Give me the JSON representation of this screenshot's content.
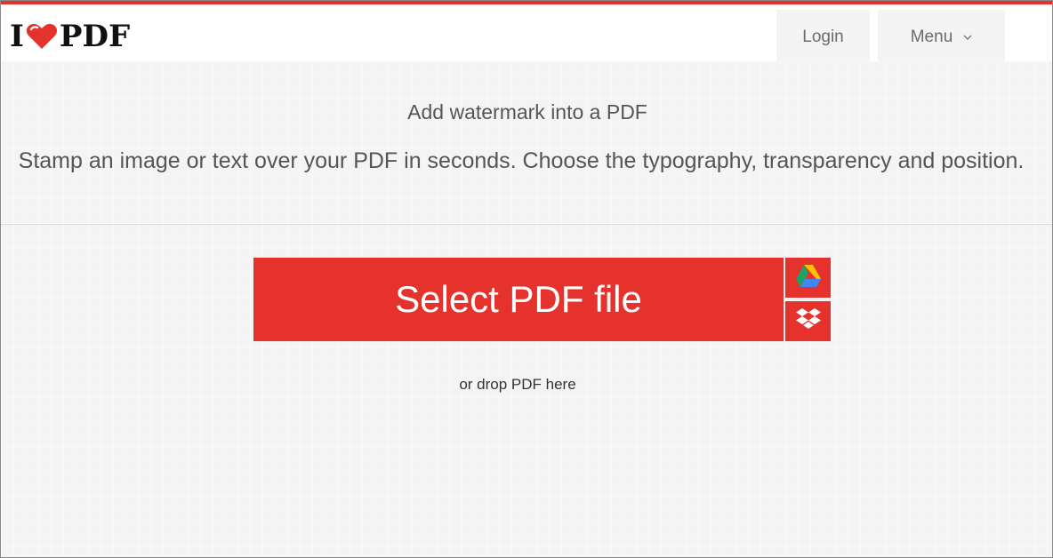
{
  "header": {
    "logo_left": "I",
    "logo_right": "PDF",
    "login_label": "Login",
    "menu_label": "Menu"
  },
  "page": {
    "title": "Add watermark into a PDF",
    "description": "Stamp an image or text over your PDF in seconds. Choose the typography, transparency and position.",
    "select_label": "Select PDF file",
    "drop_text": "or drop PDF here"
  },
  "colors": {
    "brand": "#e5322d",
    "background": "#f4f4f4"
  },
  "icons": {
    "logo_heart": "heart-icon",
    "menu_chevron": "chevron-down-icon",
    "google_drive": "google-drive-icon",
    "dropbox": "dropbox-icon"
  }
}
